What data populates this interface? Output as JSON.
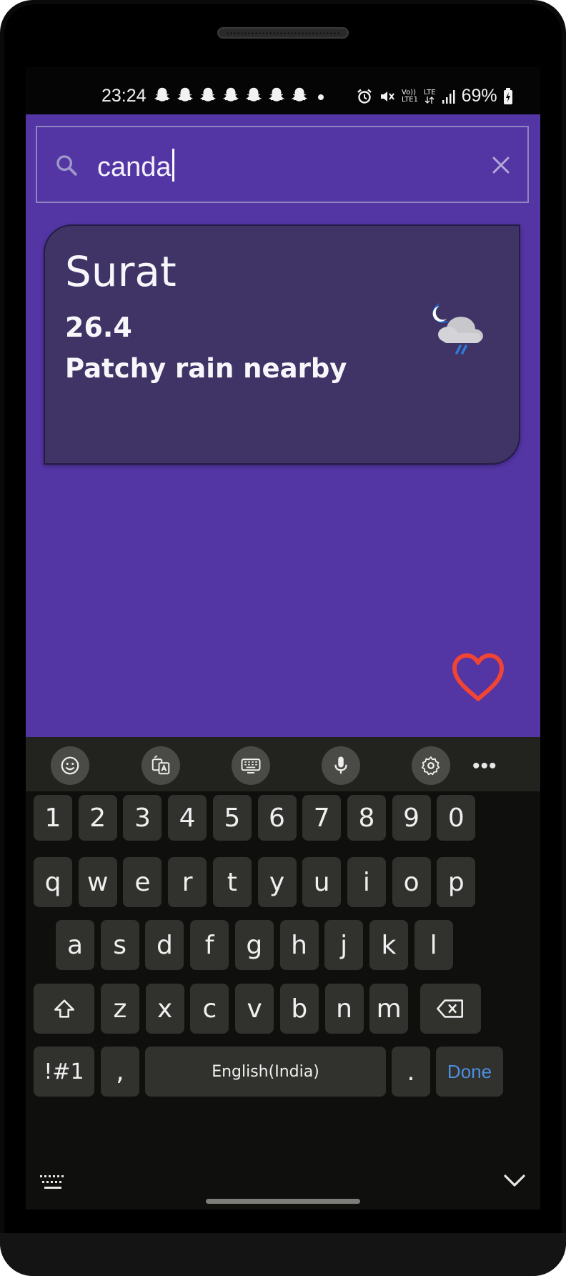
{
  "status_bar": {
    "time": "23:24",
    "notification_icons": [
      "snapchat-icon",
      "snapchat-icon",
      "snapchat-icon",
      "snapchat-icon",
      "snapchat-icon",
      "snapchat-icon",
      "snapchat-icon"
    ],
    "volte_label": "Vo))",
    "lte1_label": "LTE1",
    "lte_label": "LTE",
    "battery": "69%"
  },
  "search": {
    "query": "canda",
    "icon": "search-icon",
    "clear_icon": "close-icon"
  },
  "weather_card": {
    "city": "Surat",
    "temperature": "26.4",
    "condition": "Patchy rain nearby",
    "icon": "patchy-rain-night-icon"
  },
  "favorite": {
    "icon": "heart-outline-icon",
    "color": "#f04434"
  },
  "keyboard": {
    "toolbar": [
      "emoji-icon",
      "translate-icon",
      "keyboard-mode-icon",
      "microphone-icon",
      "settings-icon",
      "more-icon"
    ],
    "more_label": "•••",
    "rows": {
      "numbers": [
        "1",
        "2",
        "3",
        "4",
        "5",
        "6",
        "7",
        "8",
        "9",
        "0"
      ],
      "row1": [
        "q",
        "w",
        "e",
        "r",
        "t",
        "y",
        "u",
        "i",
        "o",
        "p"
      ],
      "row2": [
        "a",
        "s",
        "d",
        "f",
        "g",
        "h",
        "j",
        "k",
        "l"
      ],
      "row3": [
        "z",
        "x",
        "c",
        "v",
        "b",
        "n",
        "m"
      ]
    },
    "symbols_label": "!#1",
    "comma_label": ",",
    "space_label": "English(India)",
    "period_label": ".",
    "done_label": "Done"
  },
  "colors": {
    "app_background": "#5335a4",
    "card_background": "#3f3465",
    "keyboard_background": "#0f0f0d",
    "key_background": "#31312e",
    "done_accent": "#4c8fe0"
  }
}
